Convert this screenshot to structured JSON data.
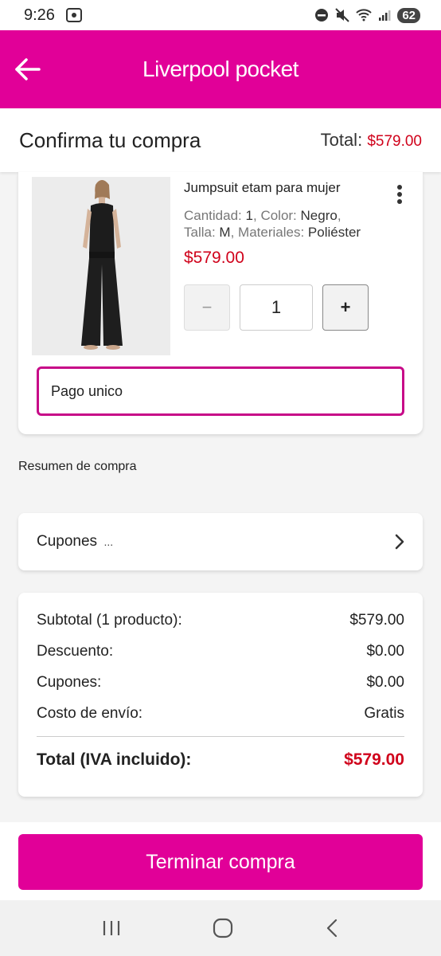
{
  "status": {
    "time": "9:26",
    "battery": "62"
  },
  "app_bar": {
    "logo_text": "Liverpool pocket"
  },
  "header": {
    "title": "Confirma tu compra",
    "total_label": "Total:",
    "total_value": "$579.00"
  },
  "product": {
    "name": "Jumpsuit etam para mujer",
    "attrs": [
      {
        "label": "Cantidad:",
        "value": "1"
      },
      {
        "label": "Color:",
        "value": "Negro"
      },
      {
        "label": "Talla:",
        "value": "M"
      },
      {
        "label": "Materiales:",
        "value": "Poliéster"
      }
    ],
    "price": "$579.00",
    "qty_minus": "−",
    "qty": "1",
    "qty_plus": "+",
    "payment_option": "Pago unico"
  },
  "summary": {
    "label": "Resumen de compra"
  },
  "coupons": {
    "label": "Cupones",
    "ellipsis": "..."
  },
  "totals": {
    "rows": [
      {
        "label": "Subtotal (1 producto):",
        "value": "$579.00"
      },
      {
        "label": "Descuento:",
        "value": "$0.00"
      },
      {
        "label": "Cupones:",
        "value": "$0.00"
      },
      {
        "label": "Costo de envío:",
        "value": "Gratis"
      }
    ],
    "grand_label": "Total (IVA incluido):",
    "grand_value": "$579.00"
  },
  "cta": {
    "label": "Terminar compra"
  },
  "colors": {
    "brand": "#e10098",
    "price_red": "#d0021b",
    "outline": "#c70a88"
  }
}
